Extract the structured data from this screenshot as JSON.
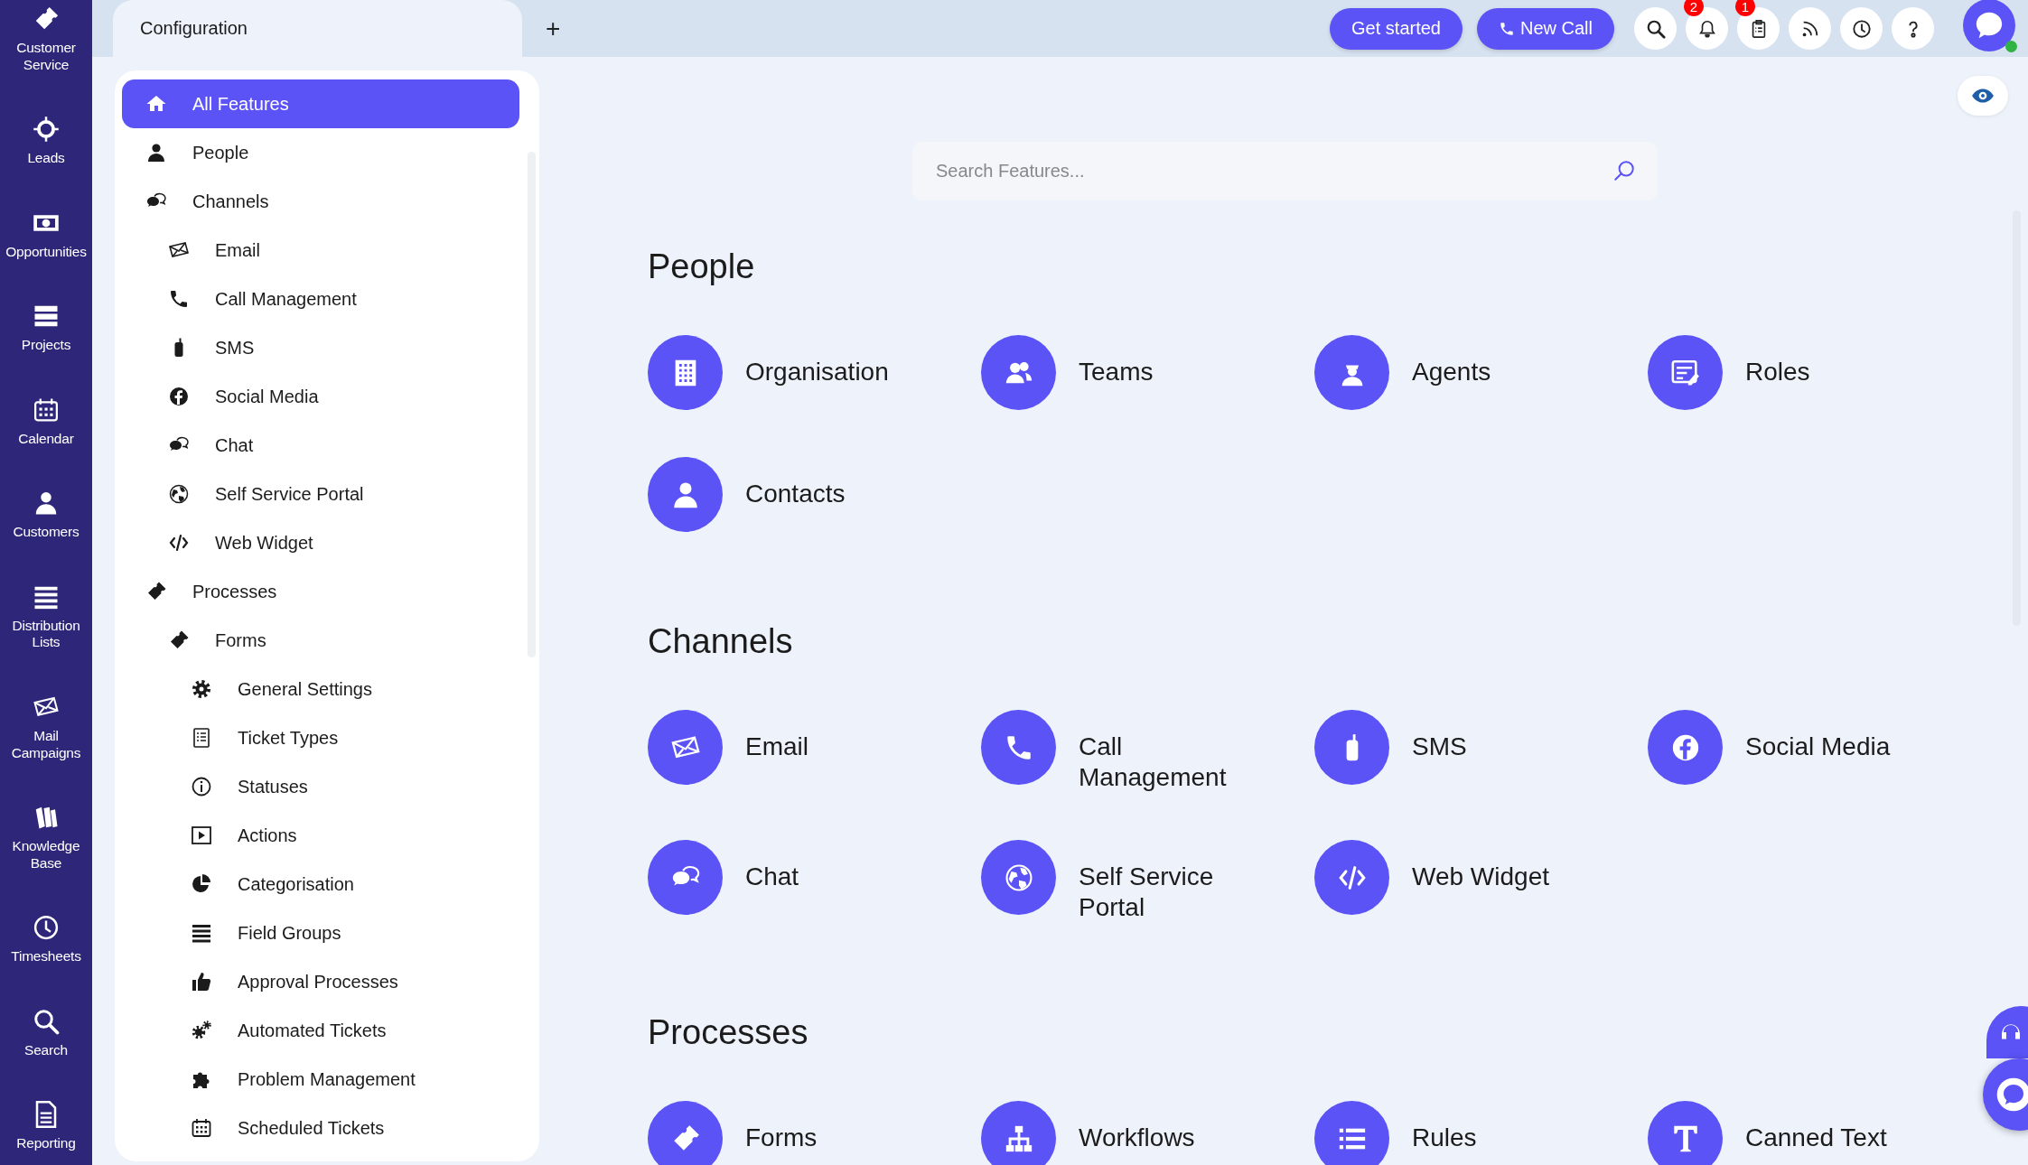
{
  "nav": [
    {
      "label": "Customer\nService"
    },
    {
      "label": "Leads"
    },
    {
      "label": "Opportunities"
    },
    {
      "label": "Projects"
    },
    {
      "label": "Calendar"
    },
    {
      "label": "Customers"
    },
    {
      "label": "Distribution\nLists"
    },
    {
      "label": "Mail\nCampaigns"
    },
    {
      "label": "Knowledge\nBase"
    },
    {
      "label": "Timesheets"
    },
    {
      "label": "Search"
    },
    {
      "label": "Reporting"
    }
  ],
  "tab": {
    "title": "Configuration",
    "add": "+"
  },
  "actions": [
    {
      "label": "Get started"
    },
    {
      "label": "New Call"
    }
  ],
  "toolbar": [
    {
      "kind": "search"
    },
    {
      "kind": "notifications",
      "badge": "2"
    },
    {
      "kind": "tasks",
      "badge": "1"
    },
    {
      "kind": "feed"
    },
    {
      "kind": "history"
    },
    {
      "kind": "help"
    }
  ],
  "user": {
    "online": true
  },
  "sidebar": {
    "items": [
      {
        "label": "All Features",
        "selected": true
      },
      {
        "label": "People",
        "selected": false
      },
      {
        "label": "Channels",
        "selected": false,
        "children": [
          {
            "label": "Email",
            "selected": false
          },
          {
            "label": "Call Management",
            "selected": false
          },
          {
            "label": "SMS",
            "selected": false
          },
          {
            "label": "Social Media",
            "selected": false
          },
          {
            "label": "Chat",
            "selected": false
          },
          {
            "label": "Self Service Portal",
            "selected": false
          },
          {
            "label": "Web Widget",
            "selected": false
          }
        ]
      },
      {
        "label": "Processes",
        "selected": false,
        "children": [
          {
            "label": "Forms",
            "selected": false,
            "children": [
              {
                "label": "General Settings",
                "selected": false
              },
              {
                "label": "Ticket Types",
                "selected": false
              },
              {
                "label": "Statuses",
                "selected": false
              },
              {
                "label": "Actions",
                "selected": false
              },
              {
                "label": "Categorisation",
                "selected": false
              },
              {
                "label": "Field Groups",
                "selected": false
              },
              {
                "label": "Approval Processes",
                "selected": false
              },
              {
                "label": "Automated Tickets",
                "selected": false
              },
              {
                "label": "Problem Management",
                "selected": false
              },
              {
                "label": "Scheduled Tickets",
                "selected": false
              }
            ]
          }
        ]
      }
    ]
  },
  "search": {
    "placeholder": "Search Features..."
  },
  "sections": [
    {
      "title": "People",
      "features": [
        {
          "label": "Organisation"
        },
        {
          "label": "Teams"
        },
        {
          "label": "Agents"
        },
        {
          "label": "Roles"
        },
        {
          "label": "Contacts"
        }
      ]
    },
    {
      "title": "Channels",
      "features": [
        {
          "label": "Email"
        },
        {
          "label": "Call Management"
        },
        {
          "label": "SMS"
        },
        {
          "label": "Social Media"
        },
        {
          "label": "Chat"
        },
        {
          "label": "Self Service Portal"
        },
        {
          "label": "Web Widget"
        }
      ]
    },
    {
      "title": "Processes",
      "features": [
        {
          "label": "Forms"
        },
        {
          "label": "Workflows"
        },
        {
          "label": "Rules"
        },
        {
          "label": "Canned Text"
        }
      ]
    }
  ]
}
